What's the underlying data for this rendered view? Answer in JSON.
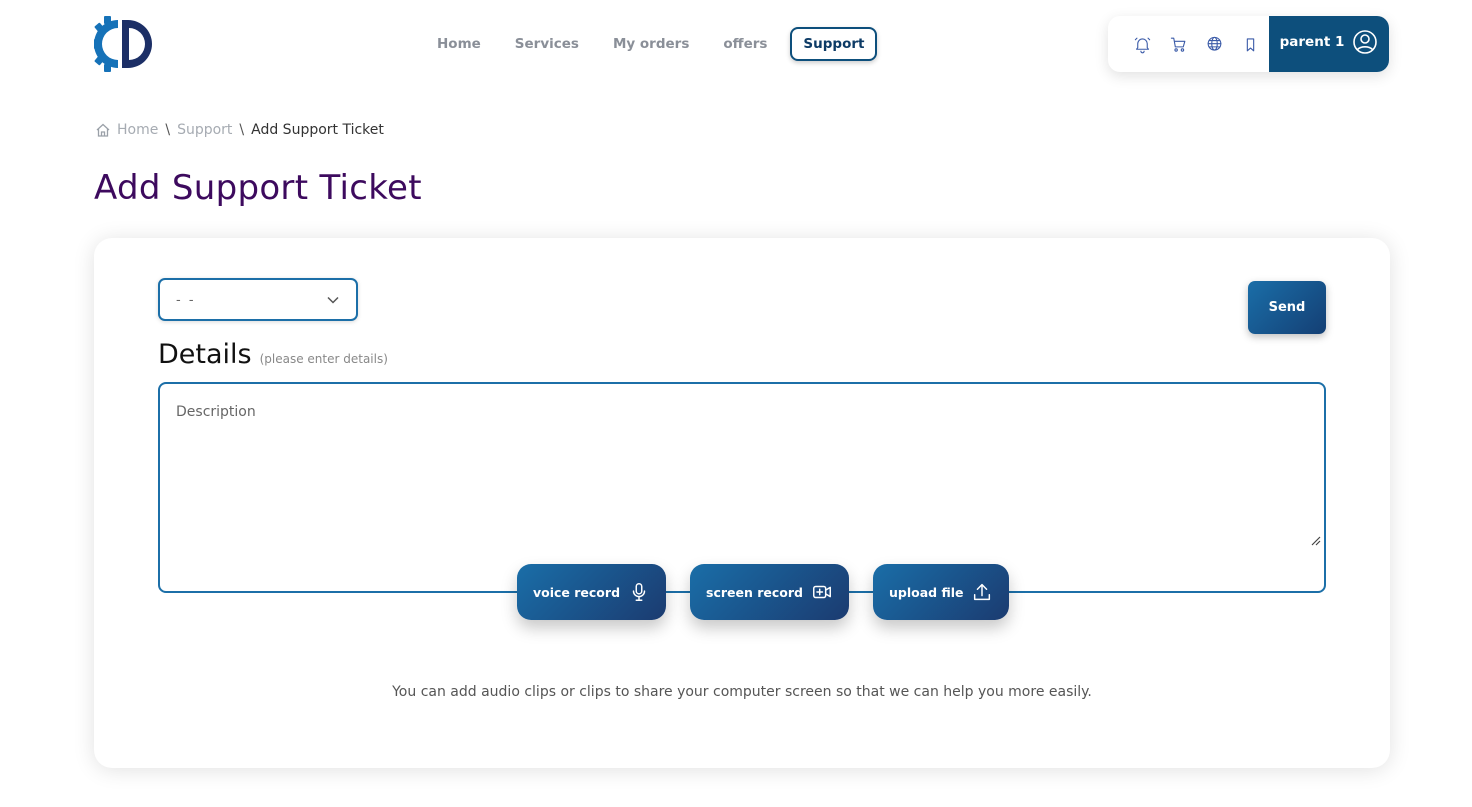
{
  "nav": {
    "items": [
      {
        "label": "Home"
      },
      {
        "label": "Services"
      },
      {
        "label": "My orders"
      },
      {
        "label": "offers"
      },
      {
        "label": "Support",
        "active": true
      }
    ]
  },
  "header": {
    "icons": [
      "bell-icon",
      "cart-icon",
      "globe-icon",
      "bookmark-icon"
    ],
    "user_name": "parent 1"
  },
  "breadcrumb": {
    "home": "Home",
    "support": "Support",
    "current": "Add Support Ticket",
    "separator": "\\"
  },
  "page": {
    "title": "Add Support Ticket"
  },
  "form": {
    "select_value": "- -",
    "send_label": "Send",
    "details_label": "Details",
    "details_hint": "(please enter details)",
    "description_placeholder": "Description",
    "voice_record_label": "voice record",
    "screen_record_label": "screen record",
    "upload_file_label": "upload file",
    "hint_text": "You can add audio clips or clips to share your computer screen so that we can help you more easily."
  },
  "colors": {
    "accent": "#0d4f7c",
    "title": "#3d0a5e",
    "border": "#1c6fa8"
  }
}
